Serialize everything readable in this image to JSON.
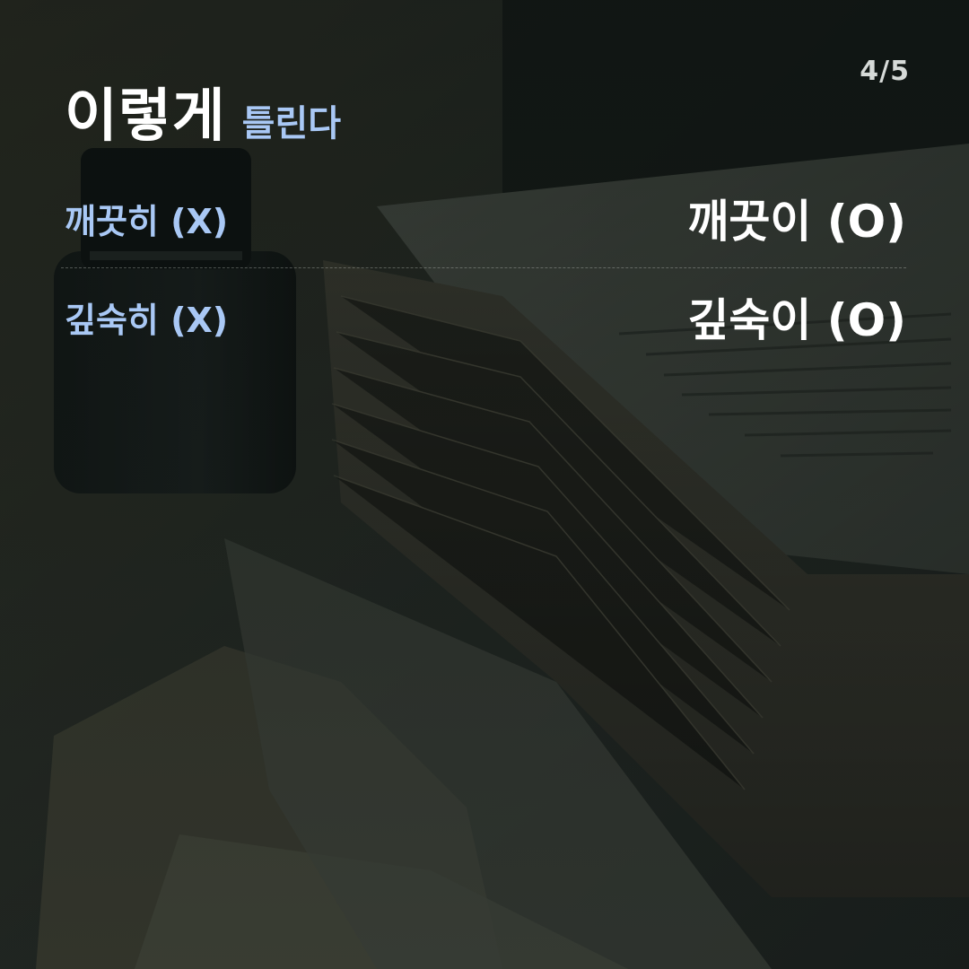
{
  "page": {
    "counter": "4/5"
  },
  "header": {
    "title_main": "이렇게",
    "title_sub": "틀린다"
  },
  "pairs": [
    {
      "wrong": "깨끗히 (X)",
      "right": "깨끗이 (O)"
    },
    {
      "wrong": "깊숙히 (X)",
      "right": "깊숙이 (O)"
    }
  ],
  "colors": {
    "accent_blue": "#a9c8f5",
    "text_white": "#ffffff",
    "background_dark": "#1a1f1d"
  },
  "background": {
    "description_icons": [
      "ink-bottle-icon",
      "paper-stack-icon"
    ]
  }
}
